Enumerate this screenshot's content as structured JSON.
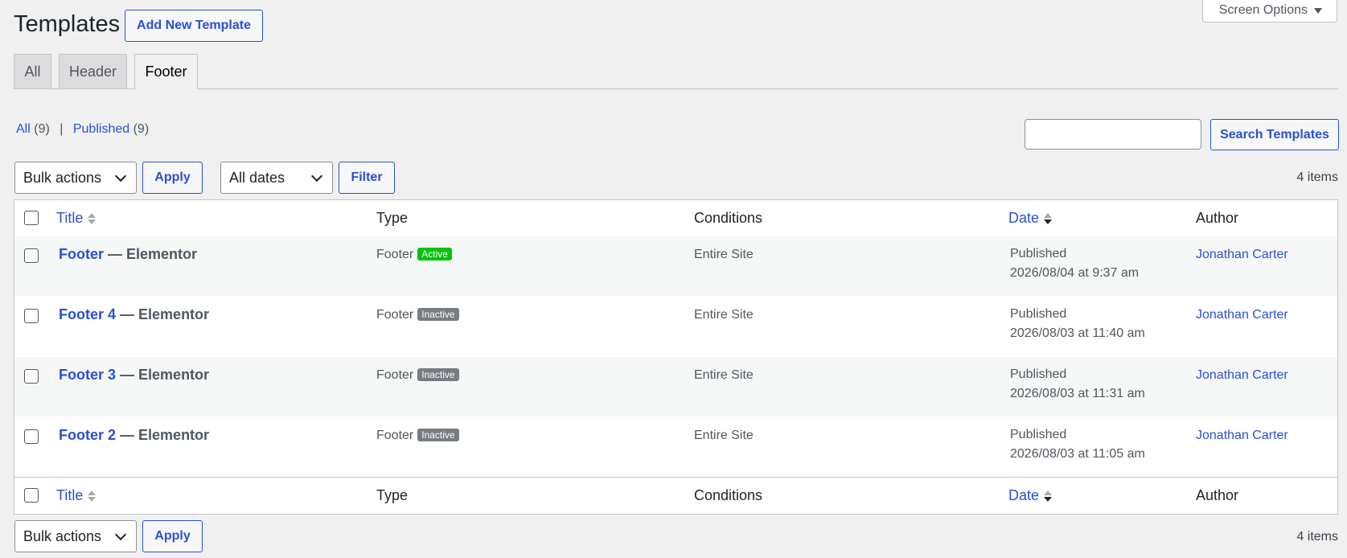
{
  "header": {
    "title": "Templates",
    "add_button": "Add New Template",
    "screen_options": "Screen Options"
  },
  "tabs": [
    {
      "label": "All",
      "active": false
    },
    {
      "label": "Header",
      "active": false
    },
    {
      "label": "Footer",
      "active": true
    }
  ],
  "filters": {
    "all_label": "All",
    "all_count": "(9)",
    "separator": "|",
    "published_label": "Published",
    "published_count": "(9)"
  },
  "search": {
    "placeholder": "",
    "button": "Search Templates"
  },
  "toolbar_top": {
    "bulk_actions": "Bulk actions",
    "apply": "Apply",
    "dates": "All dates",
    "filter": "Filter",
    "count": "4 items"
  },
  "toolbar_bottom": {
    "bulk_actions": "Bulk actions",
    "apply": "Apply",
    "count": "4 items"
  },
  "table": {
    "columns": {
      "title": "Title",
      "type": "Type",
      "conditions": "Conditions",
      "date": "Date",
      "author": "Author"
    },
    "rows": [
      {
        "title": "Footer",
        "suffix": "— Elementor",
        "type": "Footer",
        "status": "Active",
        "conditions": "Entire Site",
        "date_status": "Published",
        "date": "2026/08/04 at 9:37 am",
        "author": "Jonathan Carter"
      },
      {
        "title": "Footer 4",
        "suffix": "— Elementor",
        "type": "Footer",
        "status": "Inactive",
        "conditions": "Entire Site",
        "date_status": "Published",
        "date": "2026/08/03 at 11:40 am",
        "author": "Jonathan Carter"
      },
      {
        "title": "Footer 3",
        "suffix": "— Elementor",
        "type": "Footer",
        "status": "Inactive",
        "conditions": "Entire Site",
        "date_status": "Published",
        "date": "2026/08/03 at 11:31 am",
        "author": "Jonathan Carter"
      },
      {
        "title": "Footer 2",
        "suffix": "— Elementor",
        "type": "Footer",
        "status": "Inactive",
        "conditions": "Entire Site",
        "date_status": "Published",
        "date": "2026/08/03 at 11:05 am",
        "author": "Jonathan Carter"
      }
    ]
  },
  "colors": {
    "link": "#2c4fd1",
    "active_badge": "#00c40d",
    "inactive_badge": "#787c82"
  }
}
